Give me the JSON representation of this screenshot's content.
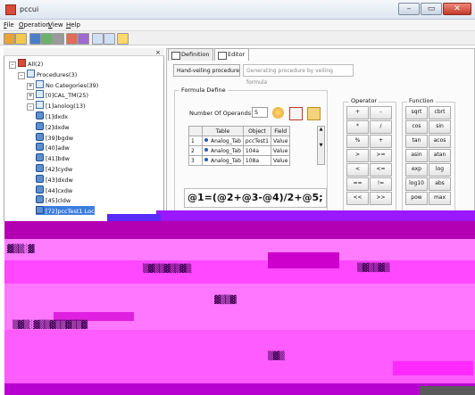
{
  "window": {
    "title": "pccui",
    "min": "–",
    "max": "▭",
    "close": "✕"
  },
  "menu": [
    {
      "label": "File",
      "accel": "F"
    },
    {
      "label": "Operation",
      "accel": "O"
    },
    {
      "label": "View",
      "accel": "V"
    },
    {
      "label": "Help",
      "accel": "H"
    }
  ],
  "tree": {
    "close": "×",
    "items": [
      {
        "label": "All(2)",
        "indent": 0,
        "exp": "–",
        "icon": "red"
      },
      {
        "label": "Procedures(3)",
        "indent": 1,
        "exp": "–",
        "icon": "node"
      },
      {
        "label": "No Categories(39)",
        "indent": 2,
        "exp": "+",
        "icon": "node"
      },
      {
        "label": "[0]CAL_TM(25)",
        "indent": 2,
        "exp": "+",
        "icon": "node"
      },
      {
        "label": "[1]anolog(13)",
        "indent": 2,
        "exp": "–",
        "icon": "node"
      },
      {
        "label": "[1]dxdx",
        "indent": 3,
        "exp": "",
        "icon": "formula"
      },
      {
        "label": "[2]dxdw",
        "indent": 3,
        "exp": "",
        "icon": "formula"
      },
      {
        "label": "[39]bgdw",
        "indent": 3,
        "exp": "",
        "icon": "formula"
      },
      {
        "label": "[40]adw",
        "indent": 3,
        "exp": "",
        "icon": "formula"
      },
      {
        "label": "[41]bdw",
        "indent": 3,
        "exp": "",
        "icon": "formula"
      },
      {
        "label": "[42]cydw",
        "indent": 3,
        "exp": "",
        "icon": "formula"
      },
      {
        "label": "[43]dxdw",
        "indent": 3,
        "exp": "",
        "icon": "formula"
      },
      {
        "label": "[44]cxdw",
        "indent": 3,
        "exp": "",
        "icon": "formula"
      },
      {
        "label": "[45]cldw",
        "indent": 3,
        "exp": "",
        "icon": "formula"
      },
      {
        "label": "[72]pccTest1 Loc",
        "indent": 3,
        "exp": "",
        "icon": "formula",
        "selected": true
      }
    ]
  },
  "tabs": [
    {
      "label": "Definition",
      "active": false
    },
    {
      "label": "Editor",
      "active": true
    }
  ],
  "editor": {
    "hand_veiling_label": "Hand-veiling procedure",
    "hand_veiling_placeholder": "Generating procedure by veiling formula",
    "formula_define_title": "Formula Define",
    "num_operands_label": "Number Of Operands",
    "num_operands_value": "5",
    "table_headers": [
      "",
      "Table",
      "Object",
      "Field"
    ],
    "rows": [
      [
        "1",
        "Analog_Tab",
        "pccTest1",
        "Value"
      ],
      [
        "2",
        "Analog_Tab",
        "104a",
        "Value"
      ],
      [
        "3",
        "Analog_Tab",
        "108a",
        "Value"
      ]
    ],
    "formula": "@1=(@2+@3-@4)/2+@5;"
  },
  "operator": {
    "title": "Operator",
    "buttons": [
      "+",
      "-",
      "*",
      "/",
      "%",
      "+",
      ">",
      ">=",
      "<",
      "<=",
      "==",
      "!=",
      "<<",
      ">>"
    ]
  },
  "function": {
    "title": "Function",
    "buttons": [
      "sqrt",
      "cbrt",
      "cos",
      "sin",
      "tan",
      "acos",
      "asin",
      "atan",
      "exp",
      "log",
      "log10",
      "abs",
      "pow",
      "max"
    ]
  }
}
